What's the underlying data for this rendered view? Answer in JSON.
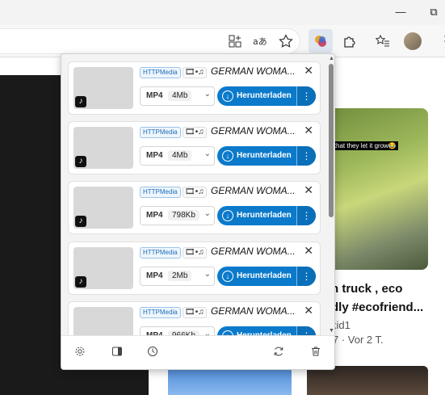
{
  "browser": {
    "window": {
      "minimize": "—",
      "restore": "⧉"
    },
    "toolbar": {
      "icons": [
        "grid-plus-icon",
        "read-aloud-icon",
        "favorite-star-icon",
        "media-extension-icon",
        "puzzle-extensions-icon",
        "favorites-list-icon",
        "profile-avatar"
      ]
    }
  },
  "page": {
    "video_caption": "a fact that they let it grow😂",
    "video_title_line1": "n truck , eco",
    "video_title_line2": "dly #ecofriend...",
    "author": "kid1",
    "meta": "· Vor 2 T."
  },
  "popup": {
    "items": [
      {
        "source": "HTTPMedia",
        "media": "🎞•♫",
        "title": "GERMAN WOMA...",
        "format": "MP4",
        "size": "4Mb",
        "download": "Herunterladen"
      },
      {
        "source": "HTTPMedia",
        "media": "🎞•♫",
        "title": "GERMAN WOMA...",
        "format": "MP4",
        "size": "4Mb",
        "download": "Herunterladen"
      },
      {
        "source": "HTTPMedia",
        "media": "🎞•♫",
        "title": "GERMAN WOMA...",
        "format": "MP4",
        "size": "798Kb",
        "download": "Herunterladen"
      },
      {
        "source": "HTTPMedia",
        "media": "🎞•♫",
        "title": "GERMAN WOMA...",
        "format": "MP4",
        "size": "2Mb",
        "download": "Herunterladen"
      },
      {
        "source": "HTTPMedia",
        "media": "🎞•♫",
        "title": "GERMAN WOMA...",
        "format": "MP4",
        "size": "966Kb",
        "download": "Herunterladen"
      }
    ],
    "footer_icons": [
      "settings-icon",
      "sidebar-panel-icon",
      "history-icon",
      "refresh-icon",
      "trash-icon"
    ]
  },
  "colors": {
    "accent": "#0b7acb",
    "badge": "#1f6fb8"
  }
}
